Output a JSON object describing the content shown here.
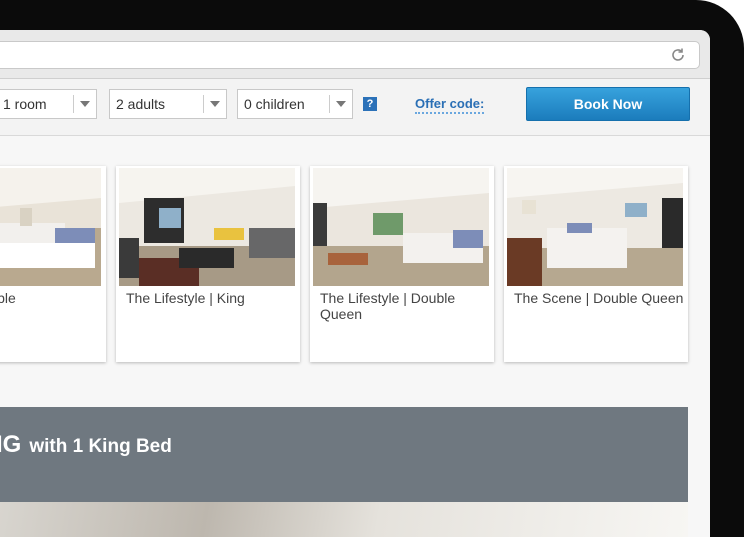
{
  "booking": {
    "rooms": "1 room",
    "adults": "2 adults",
    "children": "0 children",
    "help": "?",
    "offer_code_label": "Offer code:",
    "book_now_label": "Book Now"
  },
  "rooms": [
    {
      "name": "dard | Double"
    },
    {
      "name": "The Lifestyle | King"
    },
    {
      "name": "The Lifestyle | Double Queen"
    },
    {
      "name": "The Scene | Double Queen"
    }
  ],
  "banner": {
    "title": "IG",
    "subtitle": "with 1 King Bed"
  },
  "colors": {
    "accent": "#1b7cbc",
    "banner": "#6f7880",
    "link": "#2a6fb5"
  }
}
